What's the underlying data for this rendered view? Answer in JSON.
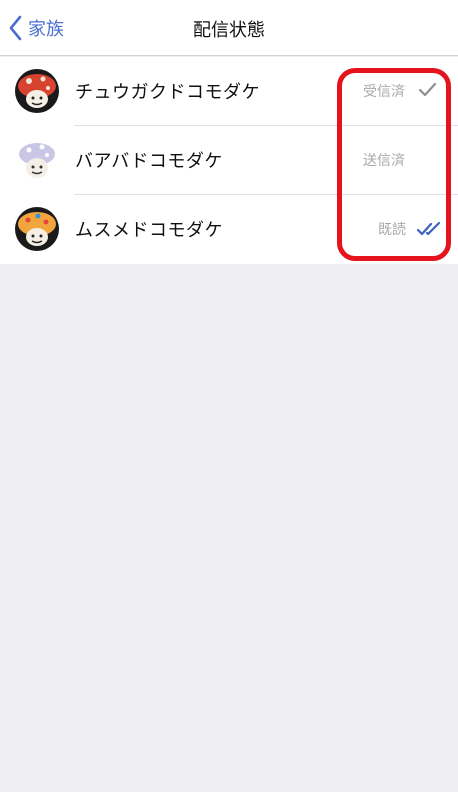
{
  "nav": {
    "back_label": "家族",
    "title": "配信状態"
  },
  "recipients": [
    {
      "name": "チュウガクドコモダケ",
      "status": "受信済",
      "status_icon": "check-icon",
      "check_color": "#8e8e93"
    },
    {
      "name": "バアバドコモダケ",
      "status": "送信済",
      "status_icon": null
    },
    {
      "name": "ムスメドコモダケ",
      "status": "既読",
      "status_icon": "double-check-icon",
      "check_color": "#3e5fc4"
    }
  ],
  "colors": {
    "accent": "#4a6fcf",
    "highlight": "#e5131d",
    "background": "#eeeef3"
  }
}
